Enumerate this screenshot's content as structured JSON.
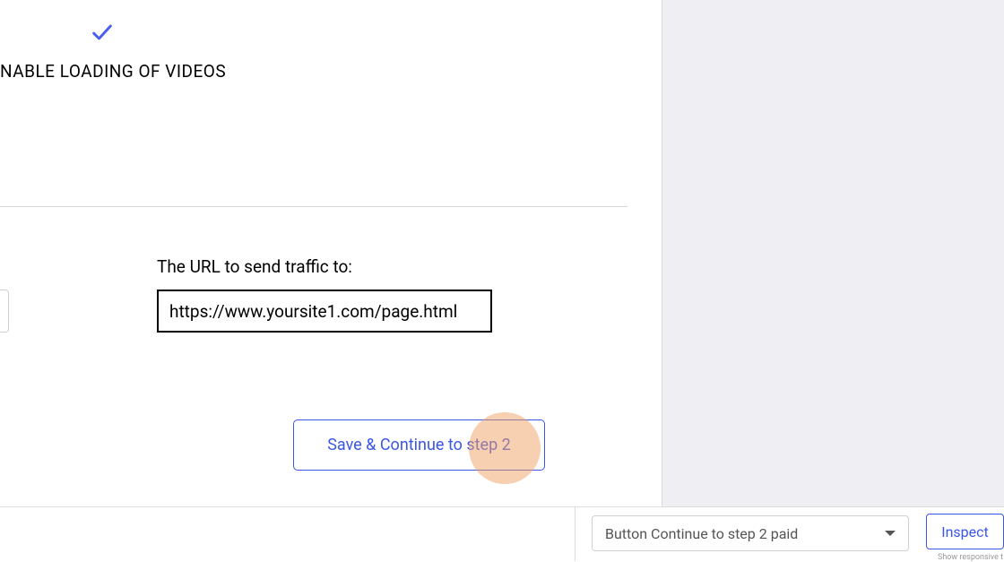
{
  "section": {
    "label": "NABLE LOADING OF VIDEOS"
  },
  "url_field": {
    "label": "The URL to send traffic to:",
    "value": "https://www.yoursite1.com/page.html"
  },
  "actions": {
    "continue_label": "Save & Continue to step 2"
  },
  "bottom_bar": {
    "dropdown_selected": "Button Continue to step 2 paid",
    "inspect_label": "Inspect",
    "responsive_hint": "Show responsive t"
  },
  "colors": {
    "accent": "#3a56e4",
    "highlight": "rgba(240,160,100,0.5)"
  }
}
